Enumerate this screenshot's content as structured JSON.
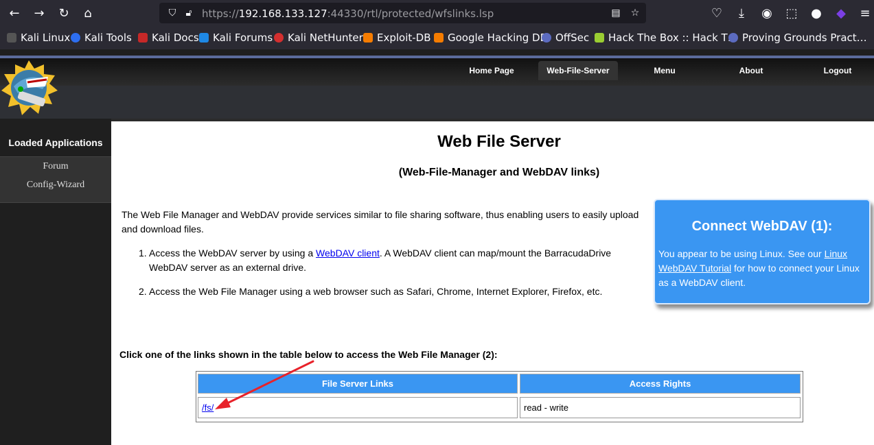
{
  "browser": {
    "url_prefix": "https://",
    "url_host": "192.168.133.127",
    "url_rest": ":44330/rtl/protected/wfslinks.lsp"
  },
  "bookmarks": [
    {
      "label": "Kali Linux",
      "color": "#444"
    },
    {
      "label": "Kali Tools",
      "color": "#2d6ef0"
    },
    {
      "label": "Kali Docs",
      "color": "#c62828"
    },
    {
      "label": "Kali Forums",
      "color": "#1e88e5"
    },
    {
      "label": "Kali NetHunter",
      "color": "#d32f2f"
    },
    {
      "label": "Exploit-DB",
      "color": "#f57c00"
    },
    {
      "label": "Google Hacking DB",
      "color": "#f57c00"
    },
    {
      "label": "OffSec",
      "color": "#5c6bc0"
    },
    {
      "label": "Hack The Box :: Hack T…",
      "color": "#9acd32"
    },
    {
      "label": "Proving Grounds Pract…",
      "color": "#5c6bc0"
    }
  ],
  "nav": {
    "home": "Home Page",
    "wfs": "Web-File-Server",
    "menu": "Menu",
    "about": "About",
    "logout": "Logout"
  },
  "sidebar": {
    "title": "Loaded Applications",
    "items": [
      "Forum",
      "Config-Wizard"
    ]
  },
  "main": {
    "title": "Web File Server",
    "subtitle": "(Web-File-Manager and WebDAV links)",
    "intro": "The Web File Manager and WebDAV provide services similar to file sharing software, thus enabling users to easily upload and download files.",
    "item1_pre": "Access the WebDAV server by using a ",
    "item1_link": "WebDAV client",
    "item1_post": ". A WebDAV client can map/mount the BarracudaDrive WebDAV server as an external drive.",
    "item2": "Access the Web File Manager using a web browser such as Safari, Chrome, Internet Explorer, Firefox, etc.",
    "click_text": "Click one of the links shown in the table below to access the Web File Manager (2):"
  },
  "webdav_box": {
    "title": "Connect WebDAV (1):",
    "text_pre": "You appear to be using Linux. See our ",
    "link": "Linux WebDAV Tutorial",
    "text_post": " for how to connect your Linux as a WebDAV client."
  },
  "table": {
    "headers": [
      "File Server Links",
      "Access Rights"
    ],
    "rows": [
      {
        "link": "/fs/",
        "rights": "read - write"
      }
    ]
  },
  "annotation_color": "#e8222a"
}
